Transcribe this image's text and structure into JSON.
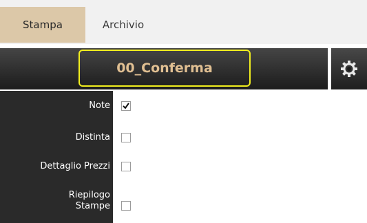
{
  "tabs": [
    {
      "label": "Stampa",
      "active": true
    },
    {
      "label": "Archivio",
      "active": false
    }
  ],
  "toolbar": {
    "title": "00_Conferma",
    "highlight_color": "#f2ef1e",
    "settings_icon": "gear-icon"
  },
  "options": [
    {
      "label": "Note",
      "checked": true
    },
    {
      "label": "Distinta",
      "checked": false
    },
    {
      "label": "Dettaglio Prezzi",
      "checked": false
    },
    {
      "label_line1": "Riepilogo",
      "label_line2": "Stampe",
      "checked": false
    }
  ]
}
